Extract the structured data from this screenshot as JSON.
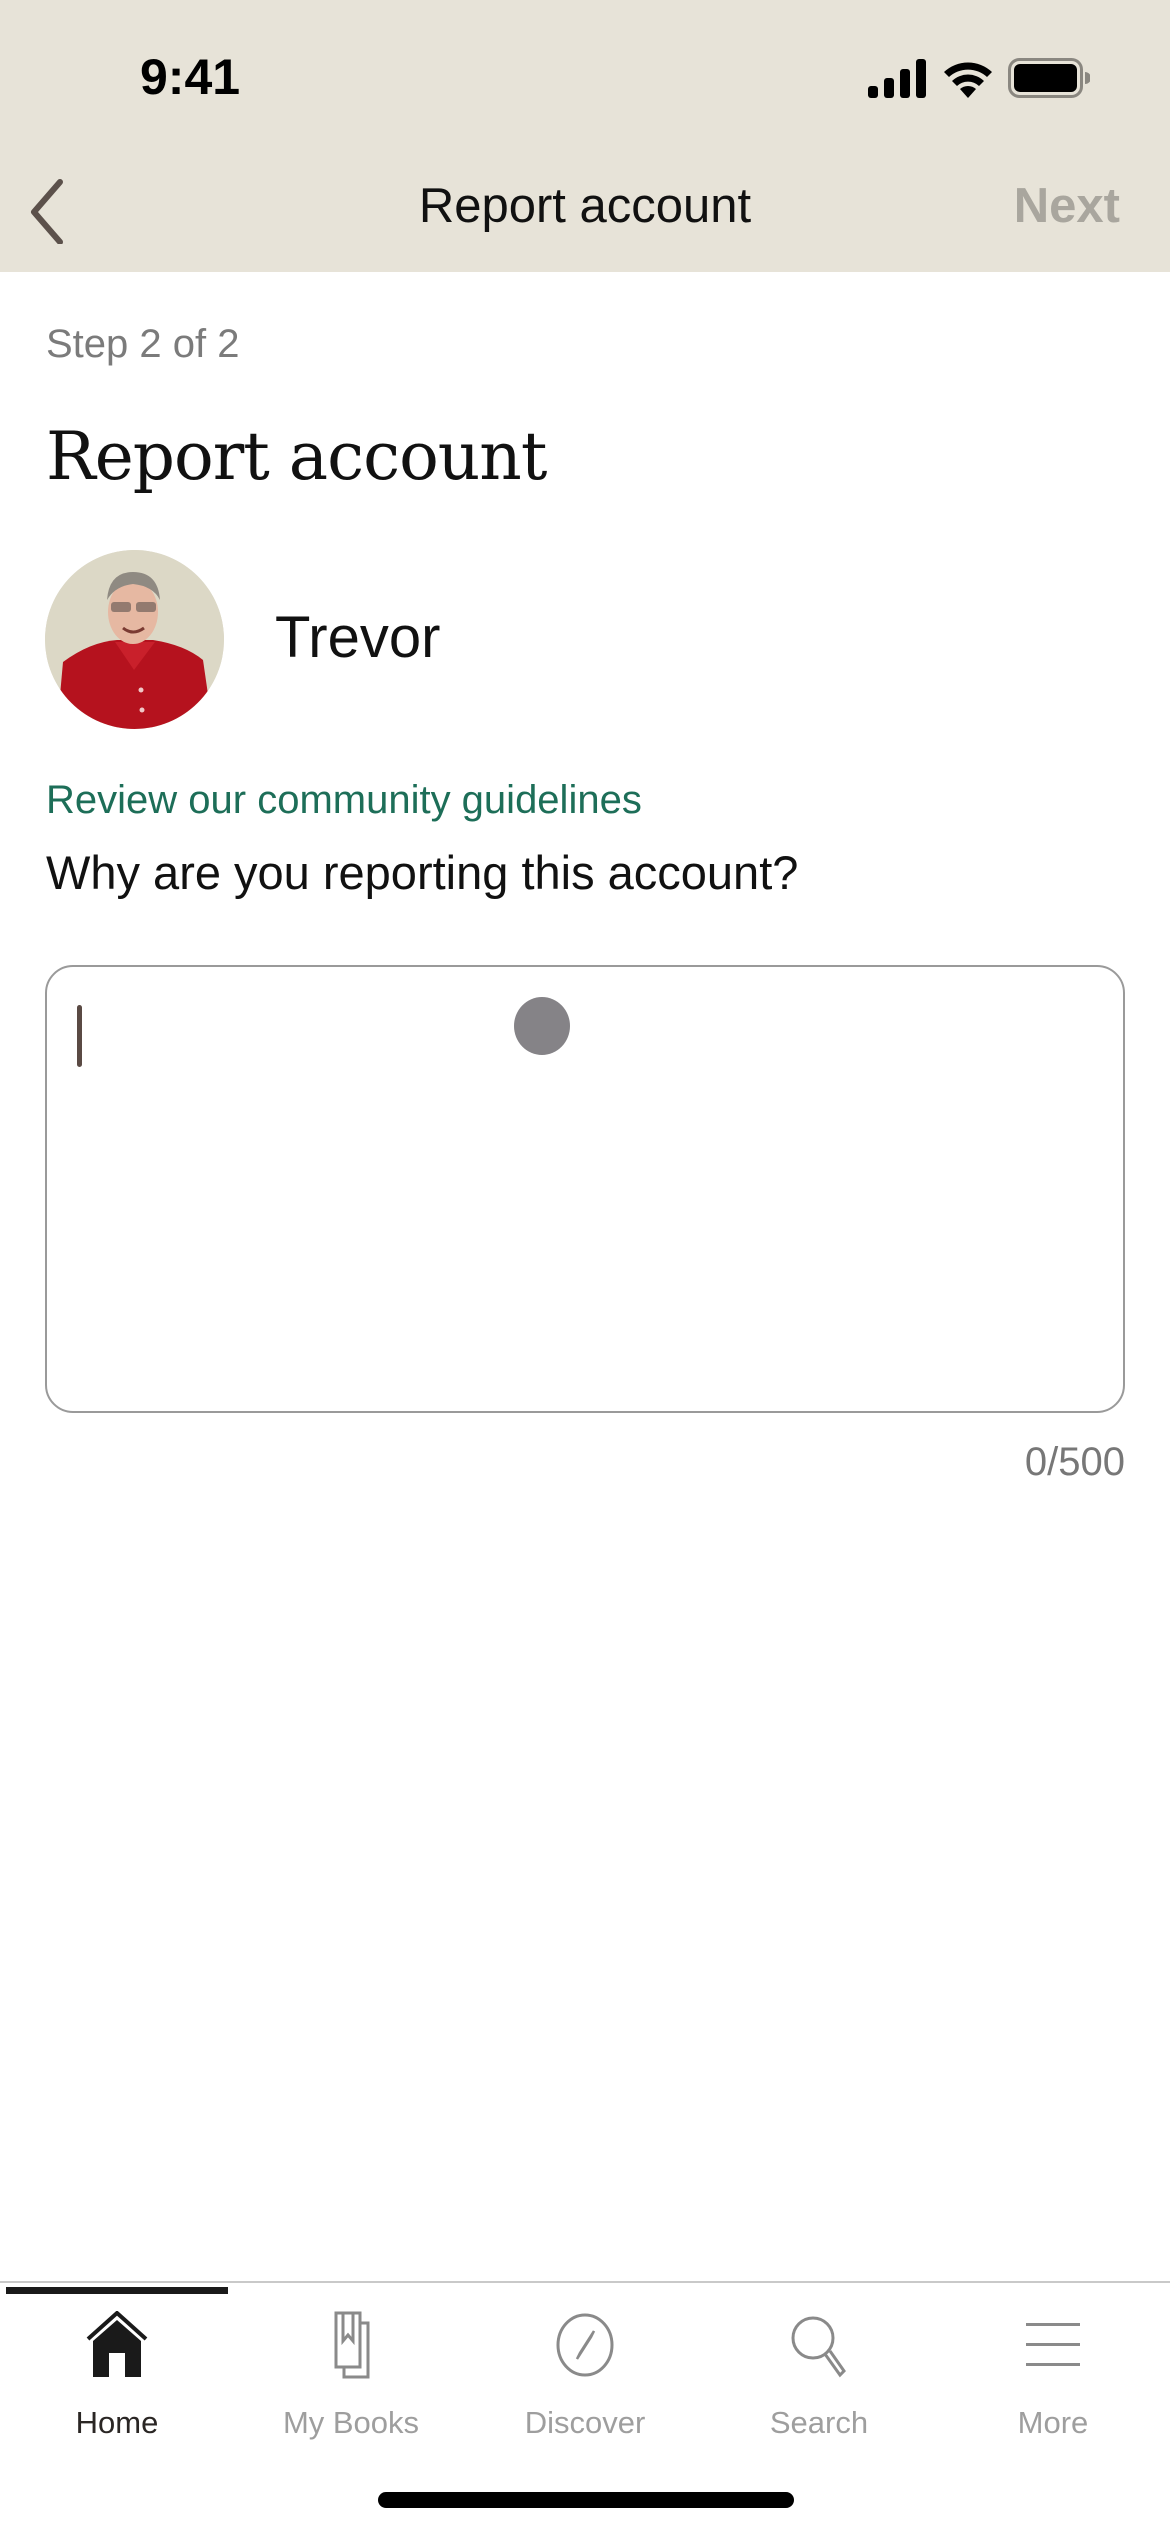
{
  "status_bar": {
    "time": "9:41",
    "icons": [
      "cellular-signal-icon",
      "wifi-icon",
      "battery-icon"
    ]
  },
  "nav": {
    "back_icon": "chevron-left-icon",
    "title": "Report account",
    "next_label": "Next",
    "next_enabled": false
  },
  "content": {
    "step": "Step 2 of 2",
    "heading": "Report account",
    "user": {
      "name": "Trevor",
      "avatar": "profile-photo"
    },
    "guidelines_link": "Review our community guidelines",
    "question": "Why are you reporting this account?",
    "reason_input": {
      "value": "",
      "placeholder": ""
    },
    "counter": "0/500"
  },
  "tabbar": {
    "tabs": [
      {
        "label": "Home",
        "icon": "home-icon",
        "active": true
      },
      {
        "label": "My Books",
        "icon": "books-icon",
        "active": false
      },
      {
        "label": "Discover",
        "icon": "compass-icon",
        "active": false
      },
      {
        "label": "Search",
        "icon": "search-icon",
        "active": false
      },
      {
        "label": "More",
        "icon": "menu-icon",
        "active": false
      }
    ]
  },
  "colors": {
    "header_bg": "#e7e3d8",
    "link": "#1d6e58",
    "disabled": "#a9a69e",
    "active_tab": "#2a2624",
    "inactive_tab": "#9e9e9e"
  }
}
